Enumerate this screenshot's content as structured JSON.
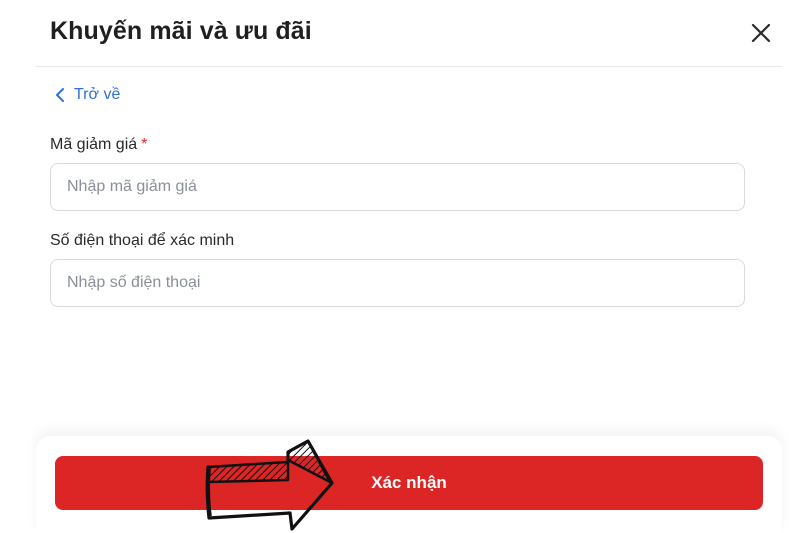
{
  "modal": {
    "title": "Khuyến mãi và ưu đãi",
    "back_label": "Trở về"
  },
  "form": {
    "coupon": {
      "label": "Mã giảm giá",
      "required_mark": "*",
      "placeholder": "Nhập mã giảm giá",
      "value": ""
    },
    "phone": {
      "label": "Số điện thoại để xác minh",
      "placeholder": "Nhập số điện thoại",
      "value": ""
    }
  },
  "footer": {
    "confirm_label": "Xác nhận"
  },
  "icons": {
    "close": "close-icon",
    "back": "chevron-left-icon",
    "annotation": "hand-drawn-arrow-icon"
  },
  "colors": {
    "accent_button": "#dc2626",
    "link": "#2f6fdb",
    "required": "#e02424"
  }
}
